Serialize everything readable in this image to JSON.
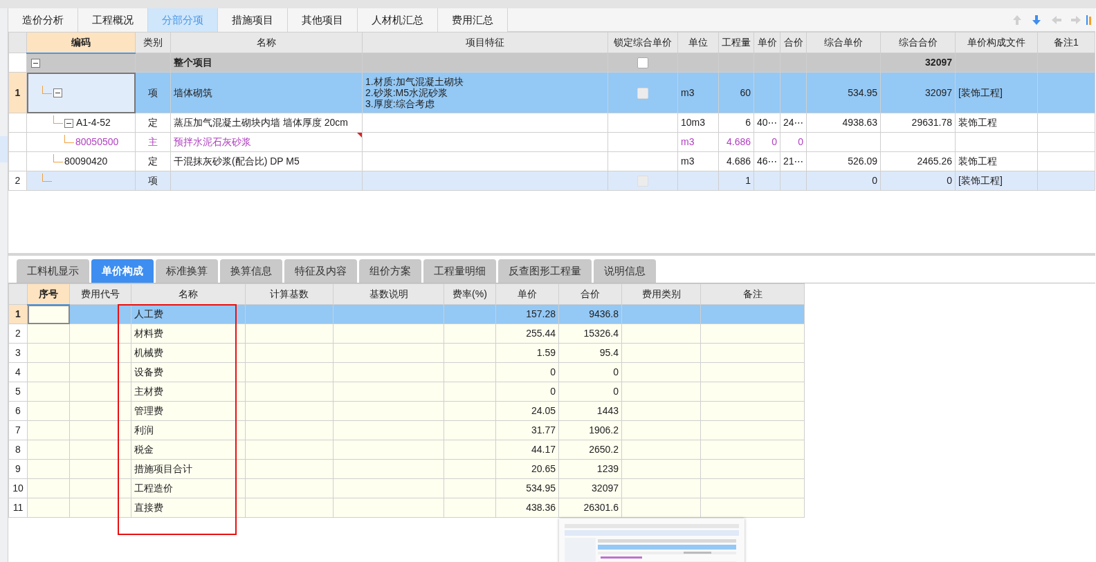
{
  "top_tabs": [
    {
      "label": "造价分析",
      "selected": false
    },
    {
      "label": "工程概况",
      "selected": false
    },
    {
      "label": "分部分项",
      "selected": true
    },
    {
      "label": "措施项目",
      "selected": false
    },
    {
      "label": "其他项目",
      "selected": false
    },
    {
      "label": "人材机汇总",
      "selected": false
    },
    {
      "label": "费用汇总",
      "selected": false
    }
  ],
  "toolbar": [
    {
      "kind": "up",
      "disabled": true
    },
    {
      "kind": "down",
      "disabled": false
    },
    {
      "kind": "left",
      "disabled": true
    },
    {
      "kind": "right",
      "disabled": true
    },
    {
      "kind": "bars",
      "disabled": false
    }
  ],
  "items_table": {
    "columns": [
      {
        "label": "编码",
        "highlighted": true
      },
      {
        "label": "类别",
        "highlighted": false
      },
      {
        "label": "名称",
        "highlighted": false
      },
      {
        "label": "项目特征",
        "highlighted": false
      },
      {
        "label": "锁定综合单价",
        "highlighted": false
      },
      {
        "label": "单位",
        "highlighted": false
      },
      {
        "label": "工程量",
        "highlighted": false
      },
      {
        "label": "单价",
        "highlighted": false
      },
      {
        "label": "合价",
        "highlighted": false
      },
      {
        "label": "综合单价",
        "highlighted": false
      },
      {
        "label": "综合合价",
        "highlighted": false
      },
      {
        "label": "单价构成文件",
        "highlighted": false
      },
      {
        "label": "备注1",
        "highlighted": false
      }
    ],
    "rows": [
      {
        "kind": "total",
        "selected": false,
        "expanded": true,
        "name": "整个项目",
        "locked": {
          "checked": false,
          "disabled": false
        },
        "composite_total": "32097",
        "children": [
          {
            "kind": "item",
            "number": "1",
            "selected": true,
            "expanded": true,
            "type": "项",
            "name": "墙体砌筑",
            "features": [
              "1.材质:加气混凝土砌块",
              "2.砂浆:M5水泥砂浆",
              "3.厚度:综合考虑"
            ],
            "locked": {
              "checked": false,
              "disabled": true
            },
            "unit": "m3",
            "quantity": "60",
            "composite_unit_price": "534.95",
            "composite_total": "32097",
            "composition_file": "[装饰工程]",
            "children": [
              {
                "kind": "quota",
                "selected": false,
                "expanded": true,
                "code": "A1-4-52",
                "type": "定",
                "name": "蒸压加气混凝土砌块内墙 墙体厚度 20cm",
                "unit": "10m3",
                "quantity": "6",
                "unit_price": "40⋯",
                "total_price": "24⋯",
                "composite_unit_price": "4938.63",
                "composite_total": "29631.78",
                "composition_file": "装饰工程",
                "children": [
                  {
                    "kind": "material",
                    "selected": false,
                    "flagged": true,
                    "code": "80050500",
                    "type": "主",
                    "name": "预拌水泥石灰砂浆",
                    "unit": "m3",
                    "quantity": "4.686",
                    "unit_price": "0",
                    "total_price": "0"
                  }
                ]
              },
              {
                "kind": "quota",
                "selected": false,
                "code": "80090420",
                "type": "定",
                "name": "干混抹灰砂浆(配合比) DP M5",
                "unit": "m3",
                "quantity": "4.686",
                "unit_price": "46⋯",
                "total_price": "21⋯",
                "composite_unit_price": "526.09",
                "composite_total": "2465.26",
                "composition_file": "装饰工程"
              }
            ]
          },
          {
            "kind": "item",
            "number": "2",
            "selected": false,
            "type": "项",
            "locked": {
              "checked": false,
              "disabled": true
            },
            "quantity": "1",
            "composite_unit_price": "0",
            "composite_total": "0",
            "composition_file": "[装饰工程]"
          }
        ]
      }
    ]
  },
  "bottom_tabs": [
    {
      "label": "工料机显示",
      "selected": false
    },
    {
      "label": "单价构成",
      "selected": true
    },
    {
      "label": "标准换算",
      "selected": false
    },
    {
      "label": "换算信息",
      "selected": false
    },
    {
      "label": "特征及内容",
      "selected": false
    },
    {
      "label": "组价方案",
      "selected": false
    },
    {
      "label": "工程量明细",
      "selected": false
    },
    {
      "label": "反查图形工程量",
      "selected": false
    },
    {
      "label": "说明信息",
      "selected": false
    }
  ],
  "cost_table": {
    "columns": [
      {
        "label": "序号",
        "highlighted": true
      },
      {
        "label": "费用代号",
        "highlighted": false
      },
      {
        "label": "名称",
        "highlighted": false
      },
      {
        "label": "计算基数",
        "highlighted": false
      },
      {
        "label": "基数说明",
        "highlighted": false
      },
      {
        "label": "费率(%)",
        "highlighted": false
      },
      {
        "label": "单价",
        "highlighted": false
      },
      {
        "label": "合价",
        "highlighted": false
      },
      {
        "label": "费用类别",
        "highlighted": false
      },
      {
        "label": "备注",
        "highlighted": false
      }
    ],
    "rows": [
      {
        "number": "1",
        "selected": true,
        "name": "人工费",
        "unit_price": "157.28",
        "total": "9436.8"
      },
      {
        "number": "2",
        "selected": false,
        "name": "材料费",
        "unit_price": "255.44",
        "total": "15326.4"
      },
      {
        "number": "3",
        "selected": false,
        "name": "机械费",
        "unit_price": "1.59",
        "total": "95.4"
      },
      {
        "number": "4",
        "selected": false,
        "name": "设备费",
        "unit_price": "0",
        "total": "0"
      },
      {
        "number": "5",
        "selected": false,
        "name": "主材费",
        "unit_price": "0",
        "total": "0"
      },
      {
        "number": "6",
        "selected": false,
        "name": "管理费",
        "unit_price": "24.05",
        "total": "1443"
      },
      {
        "number": "7",
        "selected": false,
        "name": "利润",
        "unit_price": "31.77",
        "total": "1906.2"
      },
      {
        "number": "8",
        "selected": false,
        "name": "税金",
        "unit_price": "44.17",
        "total": "2650.2"
      },
      {
        "number": "9",
        "selected": false,
        "name": "措施项目合计",
        "unit_price": "20.65",
        "total": "1239"
      },
      {
        "number": "10",
        "selected": false,
        "name": "工程造价",
        "unit_price": "534.95",
        "total": "32097"
      },
      {
        "number": "11",
        "selected": false,
        "name": "直接费",
        "unit_price": "438.36",
        "total": "26301.6"
      }
    ]
  },
  "annotation": {
    "kind": "rectangle"
  }
}
